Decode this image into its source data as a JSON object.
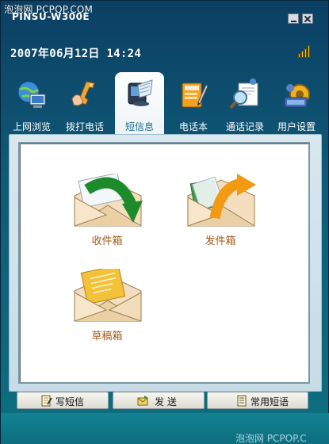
{
  "watermark_top": "泡泡网 PCPOP.COM",
  "window": {
    "title": "PINSU-W300E",
    "minimize_icon": "minimize-icon",
    "close_icon": "close-icon"
  },
  "status": {
    "datetime": "2007年06月12日  14:24",
    "signal_icon": "signal-strength-icon"
  },
  "tabs": [
    {
      "label": "上网浏览",
      "icon": "globe-computer-icon",
      "active": false
    },
    {
      "label": "拨打电话",
      "icon": "phone-hand-icon",
      "active": false
    },
    {
      "label": "短信息",
      "icon": "message-device-icon",
      "active": true
    },
    {
      "label": "电话本",
      "icon": "contacts-book-icon",
      "active": false
    },
    {
      "label": "通话记录",
      "icon": "call-log-magnifier-icon",
      "active": false
    },
    {
      "label": "用户设置",
      "icon": "user-settings-gear-icon",
      "active": false
    }
  ],
  "mailboxes": {
    "inbox": {
      "label": "收件箱",
      "icon": "inbox-envelope-icon"
    },
    "outbox": {
      "label": "发件箱",
      "icon": "outbox-envelope-icon"
    },
    "drafts": {
      "label": "草稿箱",
      "icon": "drafts-envelope-icon"
    }
  },
  "bottom_buttons": {
    "write": {
      "label": "写短信",
      "icon": "write-note-icon"
    },
    "send": {
      "label": "发 送",
      "icon": "send-envelope-icon"
    },
    "common": {
      "label": "常用短语",
      "icon": "phrase-list-icon"
    }
  },
  "watermark_bottom": "泡泡网 PCPOP.C",
  "colors": {
    "accent": "#1b6f93",
    "label_brown": "#a05a16",
    "frame_teal": "#0f5a78"
  }
}
